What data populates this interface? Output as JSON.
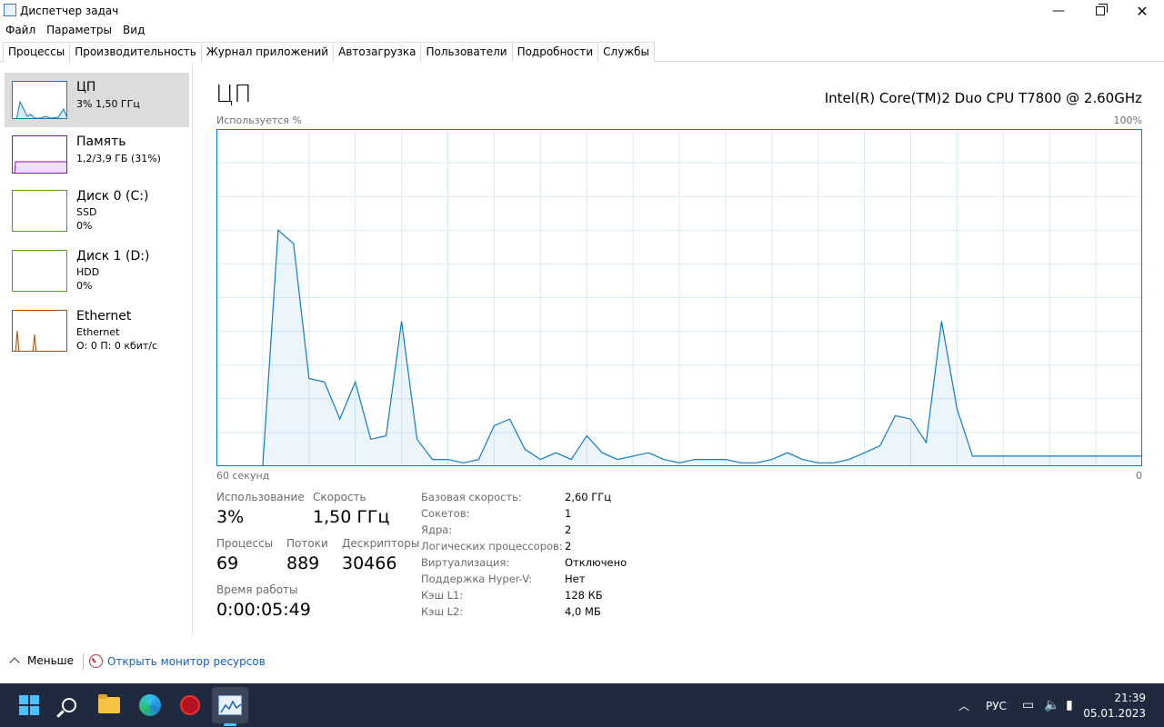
{
  "window": {
    "title": "Диспетчер задач",
    "min_glyph": "—",
    "close_glyph": "✕"
  },
  "menu": [
    "Файл",
    "Параметры",
    "Вид"
  ],
  "tabs": [
    "Процессы",
    "Производительность",
    "Журнал приложений",
    "Автозагрузка",
    "Пользователи",
    "Подробности",
    "Службы"
  ],
  "active_tab": 1,
  "sidebar": [
    {
      "name": "ЦП",
      "line1": "3% 1,50 ГГц",
      "line2": "",
      "color": "#117dbb"
    },
    {
      "name": "Память",
      "line1": "1,2/3,9 ГБ (31%)",
      "line2": "",
      "color": "#8b12ae"
    },
    {
      "name": "Диск 0 (C:)",
      "line1": "SSD",
      "line2": "0%",
      "color": "#4da60c"
    },
    {
      "name": "Диск 1 (D:)",
      "line1": "HDD",
      "line2": "0%",
      "color": "#4da60c"
    },
    {
      "name": "Ethernet",
      "line1": "Ethernet",
      "line2": "О: 0 П: 0 кбит/с",
      "color": "#a74f01"
    }
  ],
  "main": {
    "title": "ЦП",
    "model": "Intel(R) Core(TM)2 Duo CPU T7800 @ 2.60GHz",
    "used_label": "Используется %",
    "max_label": "100%",
    "seconds_label": "60 секунд",
    "zero_label": "0"
  },
  "stats": {
    "usage_label": "Использование",
    "usage_value": "3%",
    "speed_label": "Скорость",
    "speed_value": "1,50 ГГц",
    "proc_label": "Процессы",
    "proc_value": "69",
    "threads_label": "Потоки",
    "threads_value": "889",
    "handles_label": "Дескрипторы",
    "handles_value": "30466",
    "uptime_label": "Время работы",
    "uptime_value": "0:00:05:49"
  },
  "info": [
    {
      "k": "Базовая скорость:",
      "v": "2,60 ГГц"
    },
    {
      "k": "Сокетов:",
      "v": "1"
    },
    {
      "k": "Ядра:",
      "v": "2"
    },
    {
      "k": "Логических процессоров:",
      "v": "2"
    },
    {
      "k": "Виртуализация:",
      "v": "Отключено"
    },
    {
      "k": "Поддержка Hyper-V:",
      "v": "Нет"
    },
    {
      "k": "Кэш L1:",
      "v": "128 КБ"
    },
    {
      "k": "Кэш L2:",
      "v": "4,0 МБ"
    }
  ],
  "footer": {
    "fewer": "Меньше",
    "monitor": "Открыть монитор ресурсов"
  },
  "taskbar": {
    "lang": "РУС",
    "time": "21:39",
    "date": "05.01.2023"
  },
  "chart_data": {
    "type": "area",
    "ylim": [
      0,
      100
    ],
    "xlim": [
      0,
      60
    ],
    "color": "#117dbb",
    "values": [
      0,
      0,
      0,
      0,
      70,
      66,
      26,
      25,
      14,
      25,
      8,
      9,
      43,
      8,
      2,
      2,
      1,
      2,
      12,
      14,
      5,
      2,
      4,
      2,
      9,
      4,
      2,
      3,
      4,
      2,
      1,
      2,
      2,
      2,
      1,
      1,
      2,
      4,
      2,
      1,
      1,
      2,
      4,
      6,
      15,
      14,
      7,
      43,
      17,
      3,
      3,
      3,
      3,
      3,
      3,
      3,
      3,
      3,
      3,
      3,
      3
    ]
  }
}
